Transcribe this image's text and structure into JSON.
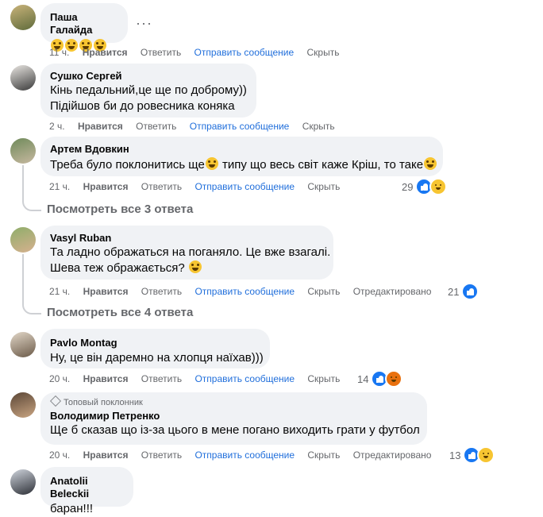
{
  "action_labels": {
    "like": "Нравится",
    "reply": "Ответить",
    "message": "Отправить сообщение",
    "hide": "Скрыть",
    "edited": "Отредактировано"
  },
  "comments": [
    {
      "author": "Паша Галайда",
      "emoji_count": 4,
      "time": "11 ч.",
      "avatar_colors": [
        "#c9b37a",
        "#5f6b3b"
      ]
    },
    {
      "author": "Сушко Сергей",
      "lines": [
        "Кінь педальний,це ще по доброму))",
        "Підійшов би до ровесника коняка"
      ],
      "time": "2 ч.",
      "avatar_colors": [
        "#e9e6e2",
        "#3a3a3a"
      ]
    },
    {
      "author": "Артем Вдовкин",
      "text_a": "Треба було поклонитись ще",
      "text_b": " типу що весь світ каже Кріш, то таке",
      "time": "21 ч.",
      "reactions": "29",
      "replies_link": "Посмотреть все 3 ответа",
      "avatar_colors": [
        "#6f8a5a",
        "#c7b8a0"
      ]
    },
    {
      "author": "Vasyl Ruban",
      "lines": [
        "Та ладно ображаться на поганяло. Це вже взагалі.",
        "Шева теж ображається?"
      ],
      "time": "21 ч.",
      "reactions": "21",
      "replies_link": "Посмотреть все 4 ответа",
      "avatar_colors": [
        "#8fae6a",
        "#d6b08e"
      ]
    },
    {
      "author": "Pavlo Montag",
      "lines": [
        "Ну, це він даремно на хлопця наїхав)))"
      ],
      "time": "20 ч.",
      "reactions": "14",
      "avatar_colors": [
        "#e2d7c8",
        "#6b5a48"
      ]
    },
    {
      "badge": "Топовый поклонник",
      "author": "Володимир Петренко",
      "lines": [
        "Ще б сказав що із-за цього в мене погано виходить грати у футбол"
      ],
      "time": "20 ч.",
      "reactions": "13",
      "avatar_colors": [
        "#5b4636",
        "#c9a582"
      ]
    },
    {
      "author": "Anatolii Beleckii",
      "lines": [
        "баран!!!"
      ],
      "avatar_colors": [
        "#cfd4dc",
        "#2c2f36"
      ]
    }
  ],
  "more_icon": "more-horizontal-icon",
  "more_glyph": "···"
}
